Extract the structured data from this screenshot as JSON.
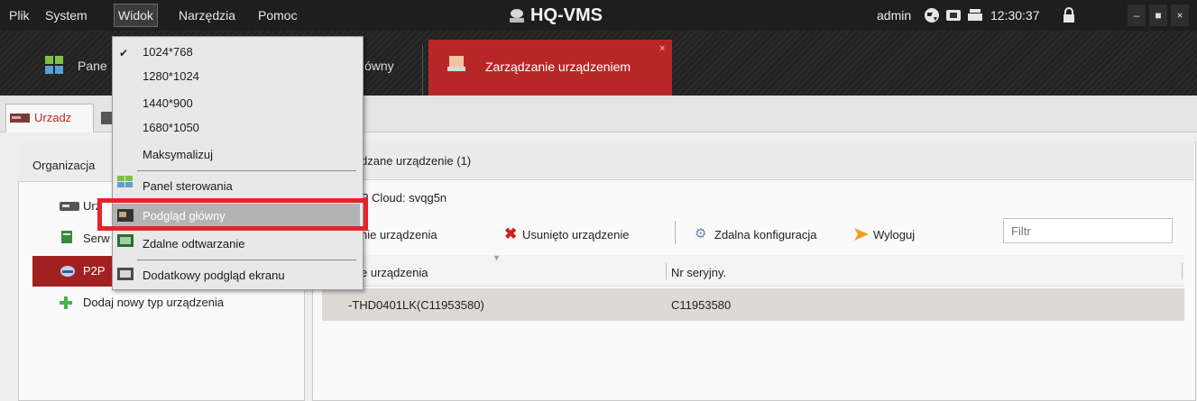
{
  "menu": [
    "Plik",
    "System",
    "Widok",
    "Narzędzia",
    "Pomoc"
  ],
  "app_title": "HQ-VMS",
  "status": {
    "user": "admin",
    "time": "12:30:37"
  },
  "status_icons": {
    "ram_label": "RAM",
    "cpu_label": "CPU"
  },
  "window_buttons": {
    "minimize": "–",
    "maximize": "■",
    "close": "×"
  },
  "tabs": {
    "left_partial": "Pane",
    "middle_partial": "ówny",
    "active": "Zarządzanie urządzeniem",
    "close": "×"
  },
  "subtab": {
    "label": "Urzadz"
  },
  "left_panel": {
    "header_partial": "Organizacja",
    "items": [
      {
        "label": "Urz"
      },
      {
        "label": "Serw"
      },
      {
        "label": "P2P"
      },
      {
        "label": "Dodaj nowy typ urządzenia"
      }
    ]
  },
  "right_panel": {
    "header": "dzane urządzenie (1)",
    "cloud_label": "P Cloud:  svqg5n",
    "toolbar": {
      "add_partial": "nie urządzenia",
      "delete": "Usunięto urządzenie",
      "remote_config": "Zdalna konfiguracja",
      "logout": "Wyloguj",
      "filter_placeholder": "Filtr"
    },
    "columns": [
      "e urządzenia",
      "Nr seryjny."
    ],
    "rows": [
      {
        "name": "-THD0401LK(C11953580)",
        "serial": "C11953580"
      }
    ]
  },
  "dropdown": {
    "items": [
      {
        "label": "1024*768",
        "checked": true
      },
      {
        "label": "1280*1024"
      },
      {
        "label": "1440*900"
      },
      {
        "label": "1680*1050"
      },
      {
        "label": "Maksymalizuj"
      },
      {
        "label": "Panel sterowania"
      },
      {
        "label": "Podgląd główny"
      },
      {
        "label": "Zdalne odtwarzanie"
      },
      {
        "label": "Dodatkowy podgląd ekranu"
      }
    ],
    "check_mark": "✔"
  },
  "colors": {
    "accent": "#b82727",
    "highlight_box": "#e3242b"
  }
}
